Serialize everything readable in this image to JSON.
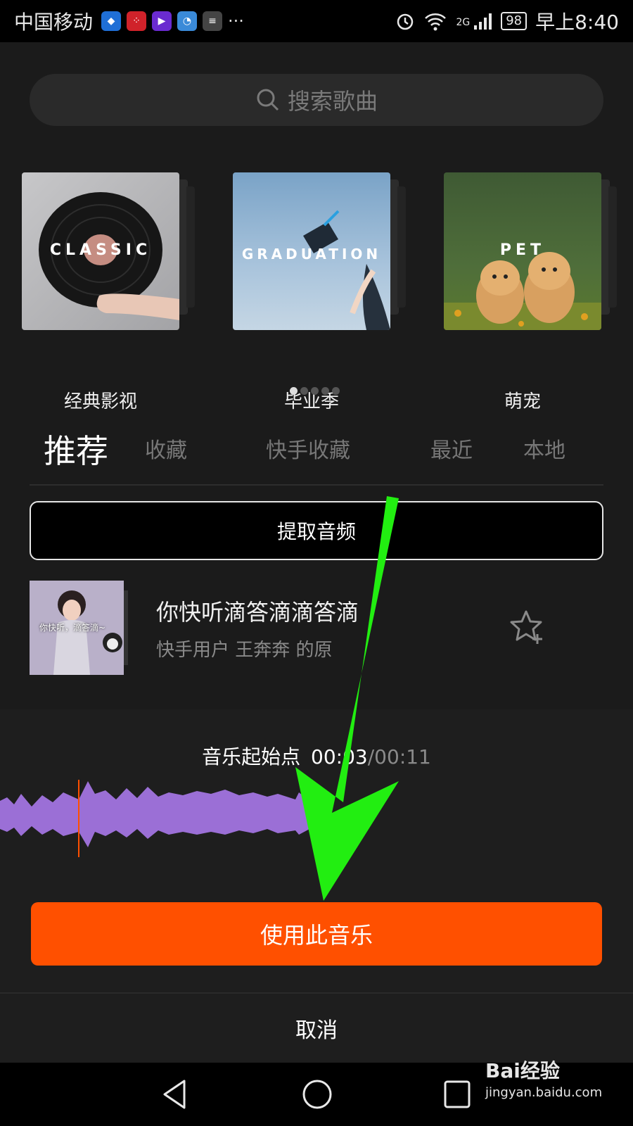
{
  "status_bar": {
    "carrier": "中国移动",
    "more": "···",
    "network": "2G",
    "battery": "98",
    "time": "早上8:40"
  },
  "search": {
    "placeholder": "搜索歌曲"
  },
  "categories": [
    {
      "cover_text": "CLASSIC",
      "label": "经典影视"
    },
    {
      "cover_text": "GRADUATION",
      "label": "毕业季"
    },
    {
      "cover_text": "PET",
      "label": "萌宠"
    }
  ],
  "tabs": [
    "推荐",
    "收藏",
    "快手收藏",
    "最近",
    "本地"
  ],
  "extract_label": "提取音频",
  "song": {
    "title": "你快听滴答滴滴答滴",
    "subtitle": "快手用户 王奔奔 的原",
    "thumb_caption": "你快听，滴答滴~"
  },
  "player": {
    "start_label": "音乐起始点",
    "current": "00:03",
    "total": "/00:11"
  },
  "use_label": "使用此音乐",
  "cancel_label": "取消",
  "watermark": {
    "main": "Bai经验",
    "sub": "jingyan.baidu.com"
  },
  "colors": {
    "accent": "#ff5000",
    "wave": "#9b6fd6",
    "arrow": "#22ee11"
  }
}
